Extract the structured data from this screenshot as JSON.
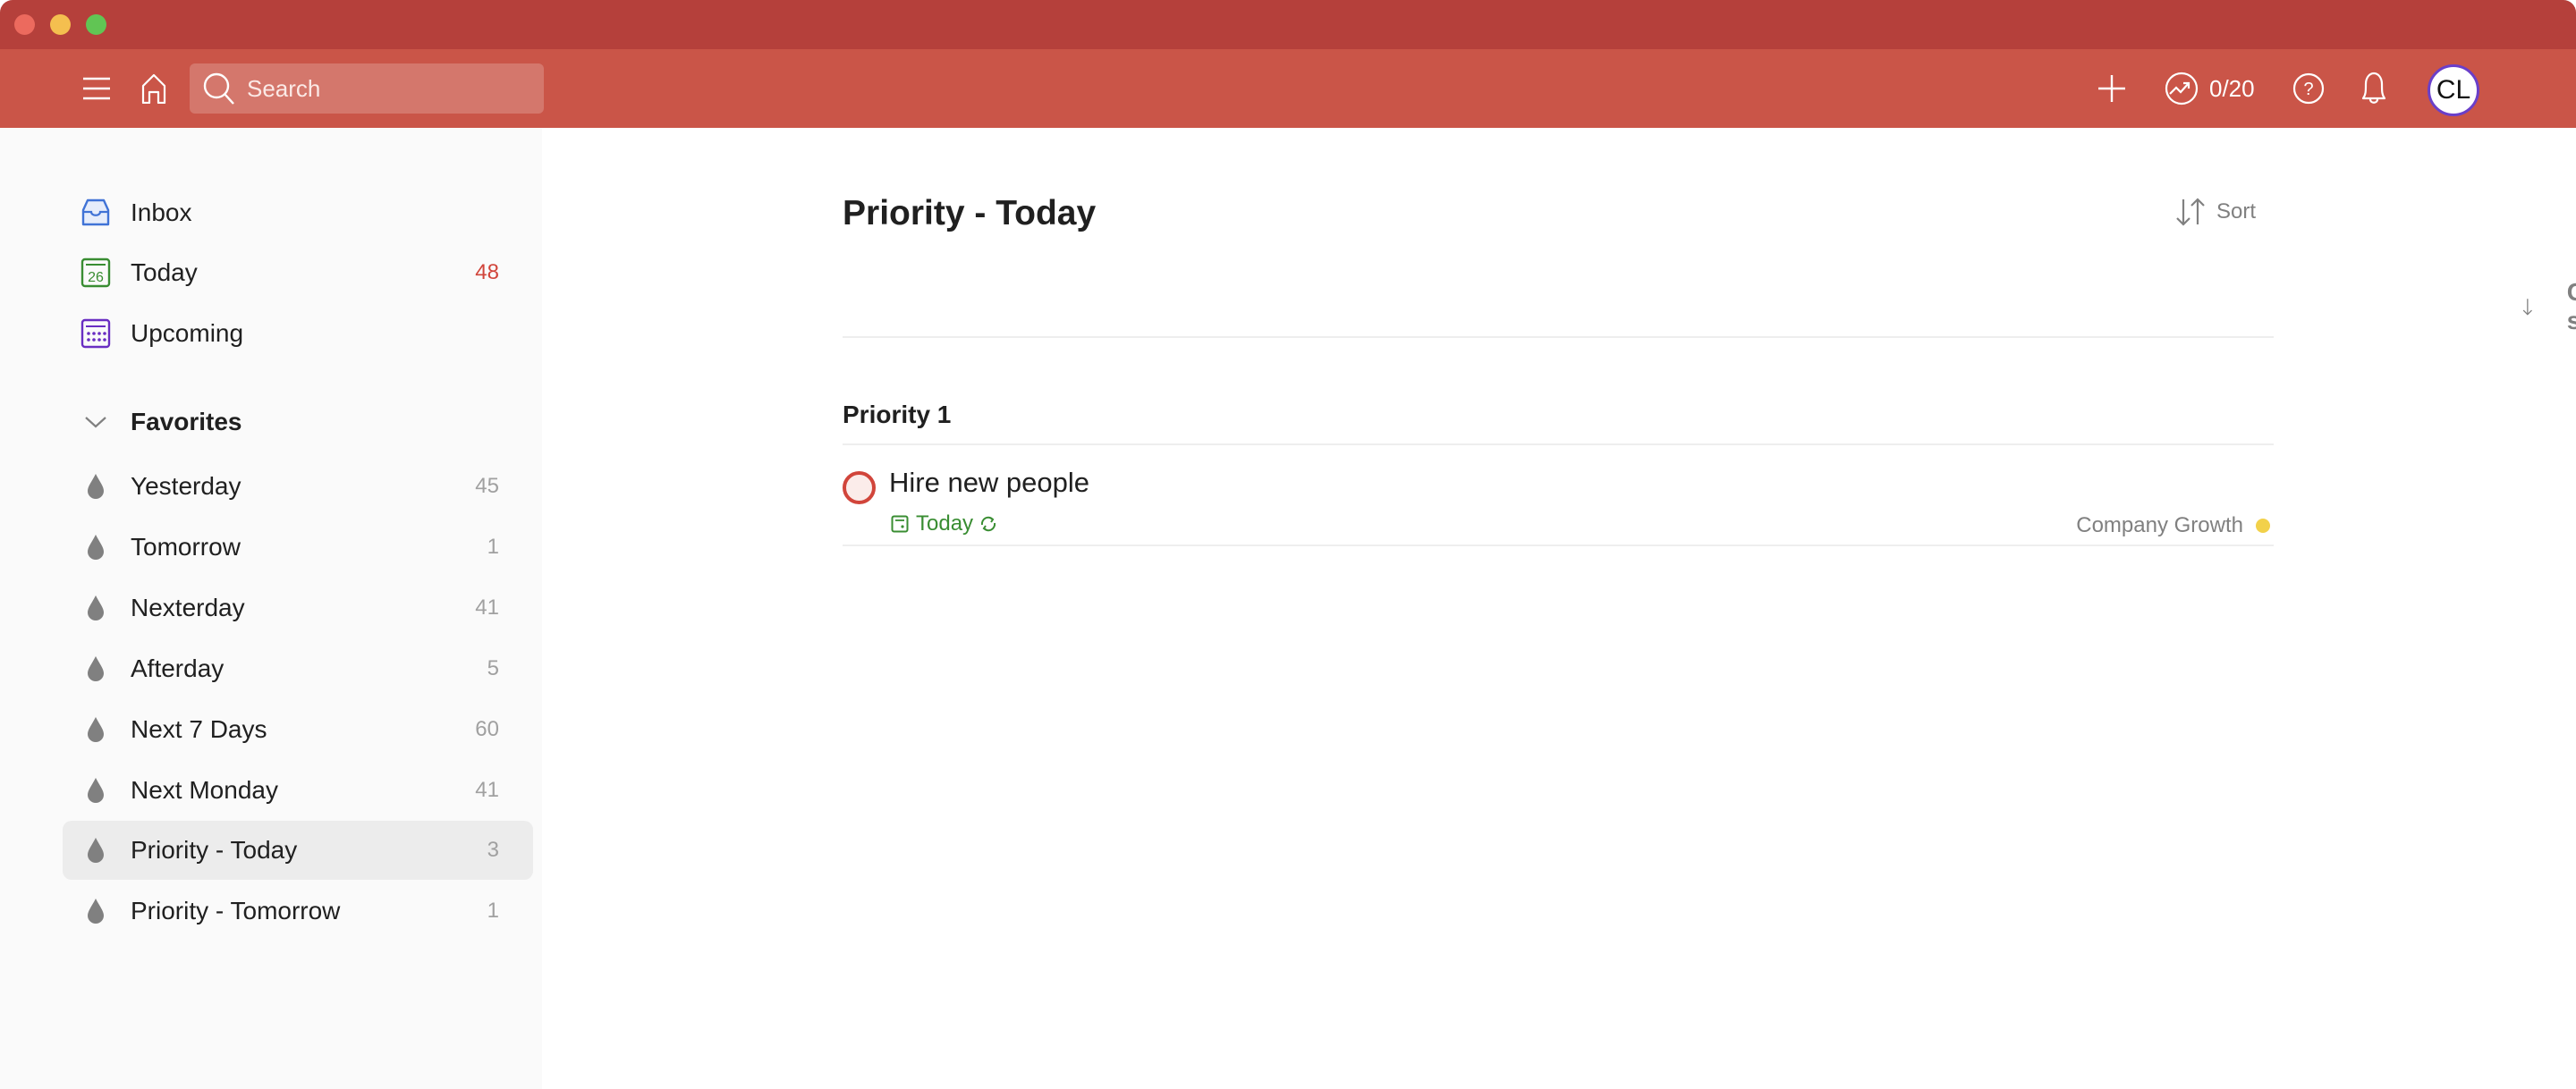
{
  "window": {
    "title_bar_buttons": [
      "close",
      "minimize",
      "zoom"
    ]
  },
  "header": {
    "menu_icon": "hamburger-menu-icon",
    "home_icon": "home-icon",
    "search": {
      "placeholder": "Search",
      "value": ""
    },
    "add_icon": "plus-icon",
    "karma": {
      "icon": "trend-up-icon",
      "value": "0/20"
    },
    "help_icon": "question-circle-icon",
    "notifications_icon": "bell-icon",
    "avatar_initials": "CL"
  },
  "sidebar": {
    "nav": [
      {
        "label": "Inbox",
        "icon": "inbox-icon",
        "count": ""
      },
      {
        "label": "Today",
        "icon": "calendar-today-icon",
        "icon_text": "26",
        "count": "48"
      },
      {
        "label": "Upcoming",
        "icon": "calendar-upcoming-icon",
        "count": ""
      }
    ],
    "favorites_label": "Favorites",
    "favorites": [
      {
        "label": "Yesterday",
        "count": "45"
      },
      {
        "label": "Tomorrow",
        "count": "1"
      },
      {
        "label": "Nexterday",
        "count": "41"
      },
      {
        "label": "Afterday",
        "count": "5"
      },
      {
        "label": "Next 7 Days",
        "count": "60"
      },
      {
        "label": "Next Monday",
        "count": "41"
      },
      {
        "label": "Priority - Today",
        "count": "3",
        "selected": true
      },
      {
        "label": "Priority - Tomorrow",
        "count": "1"
      }
    ]
  },
  "main": {
    "title": "Priority - Today",
    "sort_label": "Sort",
    "custom_sorting_label": "Custom sorting",
    "sections": [
      {
        "title": "Priority 1",
        "tasks": [
          {
            "title": "Hire new people",
            "due": "Today",
            "recurring": true,
            "project": "Company Growth",
            "project_color": "#f2d14a",
            "priority_color": "#d1453b"
          }
        ]
      }
    ]
  },
  "colors": {
    "titlebar": "#b5403b",
    "header": "#ca5548",
    "accent_red": "#d1453b",
    "today_green": "#398d32",
    "inbox_blue": "#4073d6",
    "upcoming_purple": "#692ec2"
  }
}
